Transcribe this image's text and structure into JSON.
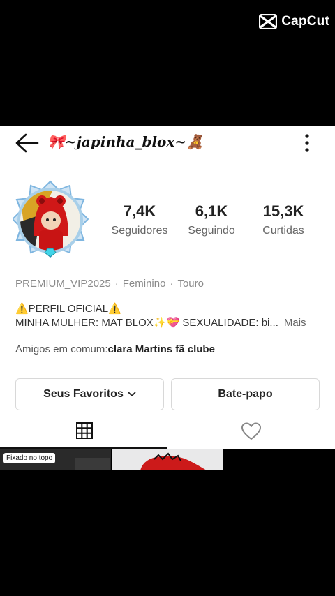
{
  "watermark": {
    "brand": "CapCut"
  },
  "header": {
    "username": "🎀~japinha_blox~🧸"
  },
  "stats": [
    {
      "value": "7,4K",
      "label": "Seguidores"
    },
    {
      "value": "6,1K",
      "label": "Seguindo"
    },
    {
      "value": "15,3K",
      "label": "Curtidas"
    }
  ],
  "meta": {
    "tag": "PREMIUM_VIP2025",
    "gender": "Feminino",
    "sign": "Touro"
  },
  "bio": {
    "line1": "⚠️PERFIL OFICIAL⚠️",
    "line2": "MINHA MULHER: MAT BLOX✨💝 SEXUALIDADE: bi...",
    "more": "Mais"
  },
  "mutual": {
    "prefix": "Amigos em comum:",
    "name": "clara Martins fã clube"
  },
  "buttons": {
    "favorites": "Seus Favoritos",
    "chat": "Bate-papo"
  },
  "thumbnails": {
    "pinned_badge": "Fixado no topo"
  },
  "colors": {
    "background": "#000000",
    "panel": "#ffffff",
    "text_muted": "#8a8a8a",
    "avatar_red": "#d01818",
    "avatar_ring": "#7fb6e0"
  }
}
